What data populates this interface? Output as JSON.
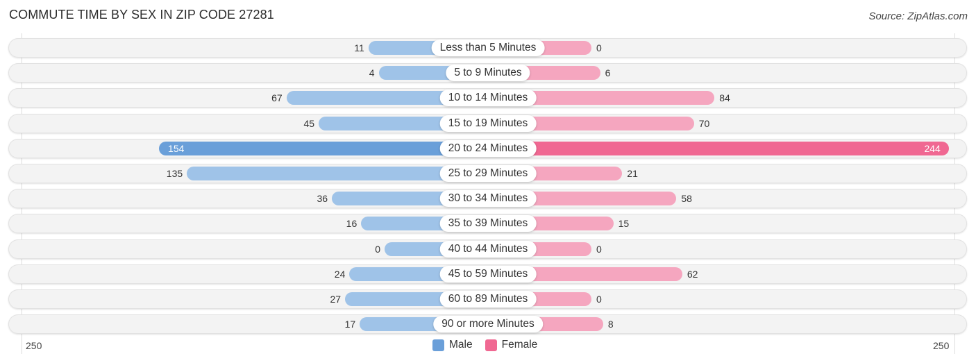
{
  "title": "COMMUTE TIME BY SEX IN ZIP CODE 27281",
  "source": "Source: ZipAtlas.com",
  "colors": {
    "male": "#9fc3e8",
    "male_strong": "#6a9fd9",
    "female": "#f5a6bf",
    "female_strong": "#f06892",
    "row_bg": "#f3f3f3"
  },
  "chart_data": {
    "type": "bar",
    "orientation": "horizontal-diverging",
    "title": "COMMUTE TIME BY SEX IN ZIP CODE 27281",
    "categories": [
      "Less than 5 Minutes",
      "5 to 9 Minutes",
      "10 to 14 Minutes",
      "15 to 19 Minutes",
      "20 to 24 Minutes",
      "25 to 29 Minutes",
      "30 to 34 Minutes",
      "35 to 39 Minutes",
      "40 to 44 Minutes",
      "45 to 59 Minutes",
      "60 to 89 Minutes",
      "90 or more Minutes"
    ],
    "series": [
      {
        "name": "Male",
        "values": [
          11,
          4,
          67,
          45,
          154,
          135,
          36,
          16,
          0,
          24,
          27,
          17
        ]
      },
      {
        "name": "Female",
        "values": [
          0,
          6,
          84,
          70,
          244,
          21,
          58,
          15,
          0,
          62,
          0,
          8
        ]
      }
    ],
    "axis": {
      "left_max_label": "250",
      "right_max_label": "250",
      "range": [
        250,
        250
      ]
    },
    "legend": {
      "position": "bottom-center",
      "entries": [
        "Male",
        "Female"
      ]
    },
    "grid": false
  }
}
